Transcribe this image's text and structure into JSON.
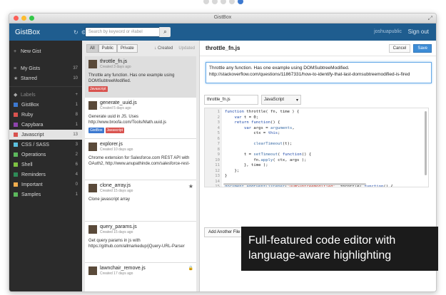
{
  "pager": {
    "count": 5,
    "active": 4
  },
  "window": {
    "title": "GistBox"
  },
  "header": {
    "brand": "GistBox",
    "search_placeholder": "Search by keyword or #label",
    "user": "joshuapublic",
    "signout": "Sign out"
  },
  "sidebar": {
    "new_gist": "New Gist",
    "my_gists": {
      "label": "My Gists",
      "count": "37"
    },
    "starred": {
      "label": "Starred",
      "count": "10"
    },
    "labels_header": "Labels",
    "labels": [
      {
        "name": "GistBox",
        "count": "1",
        "color": "#3d79d0"
      },
      {
        "name": "Ruby",
        "count": "8",
        "color": "#d9534f"
      },
      {
        "name": "Capybara",
        "count": "1",
        "color": "#8e44ad"
      },
      {
        "name": "Javascript",
        "count": "13",
        "color": "#d9534f",
        "active": true
      },
      {
        "name": "CSS / SASS",
        "count": "3",
        "color": "#5bc0de"
      },
      {
        "name": "Operations",
        "count": "2",
        "color": "#5cb85c"
      },
      {
        "name": "Shell",
        "count": "6",
        "color": "#7dc242"
      },
      {
        "name": "Reminders",
        "count": "4",
        "color": "#2e8b57"
      },
      {
        "name": "Important",
        "count": "0",
        "color": "#f0ad4e"
      },
      {
        "name": "Samples",
        "count": "1",
        "color": "#5cb85c"
      }
    ]
  },
  "list": {
    "filters": [
      "All",
      "Public",
      "Private"
    ],
    "sort_created": "Created",
    "sort_updated": "Updated",
    "gists": [
      {
        "name": "throttle_fn.js",
        "date": "Created 3 days ago",
        "desc": "Throttle any function. Has one example using DOMSubtreeModified.",
        "tags": [
          {
            "text": "Javascript",
            "color": "#d9534f"
          }
        ],
        "selected": true
      },
      {
        "name": "generate_uuid.js",
        "date": "Created 5 days ago",
        "desc": "Generate uuid in JS. Uses http://www.broofa.com/Tools/Math.uuid.js",
        "tags": [
          {
            "text": "GistBox",
            "color": "#3d79d0"
          },
          {
            "text": "Javascript",
            "color": "#d9534f"
          }
        ]
      },
      {
        "name": "explorer.js",
        "date": "Created 10 days ago",
        "desc": "Chrome extension for Salesforce.com REST API with OAuth2, http://www.anupathinde.com/salesforce-rest-",
        "tags": []
      },
      {
        "name": "clone_array.js",
        "date": "Created 15 days ago",
        "desc": "Clone javascript array",
        "tags": [],
        "starred": true
      },
      {
        "name": "query_params.js",
        "date": "Created 15 days ago",
        "desc": "Get query params in js with https://github.com/allmarkedup/jQuery-URL-Parser",
        "tags": []
      },
      {
        "name": "lawnchair_remove.js",
        "date": "Created 17 days ago",
        "desc": "",
        "tags": [],
        "locked": true
      }
    ]
  },
  "editor": {
    "title": "throttle_fn.js",
    "cancel": "Cancel",
    "save": "Save",
    "description": "Throttle any function. Has one example using DOMSubtreeModified. http://stackoverflow.com/questions/11867331/how-to-identify-that-last-domsubtreemodified-is-fired",
    "filename": "throttle_fn.js",
    "language": "JavaScript",
    "add_file": "Add Another File",
    "code_lines": [
      "function throttle( fn, time ) {",
      "    var t = 0;",
      "    return function() {",
      "        var args = arguments,",
      "            ctx = this;",
      "",
      "            clearTimeout(t);",
      "",
      "        t = setTimeout( function() {",
      "            fn.apply( ctx, args );",
      "        }, time );",
      "    };",
      "}",
      "",
      "document.addEventListener(\"DOMSubtreeModified\", throttle( function() {",
      "    //code"
    ]
  },
  "caption": "Full-featured code editor with language-aware highlighting"
}
